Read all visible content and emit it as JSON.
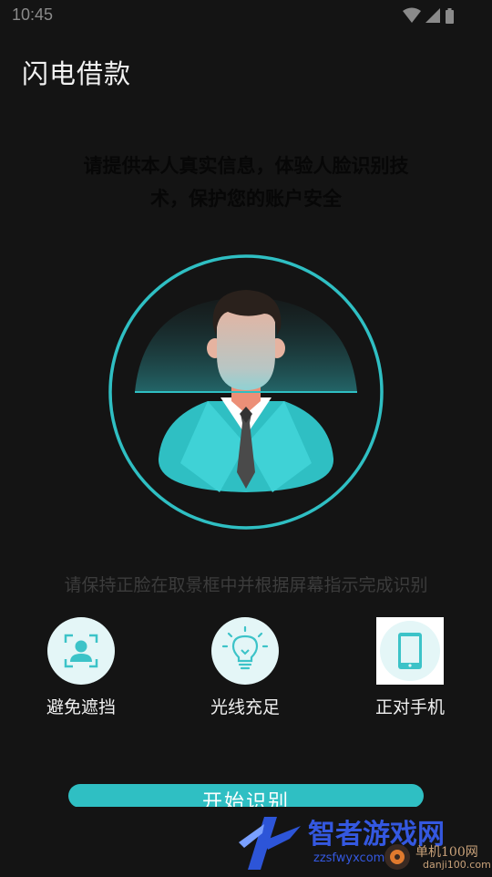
{
  "status_bar": {
    "time": "10:45",
    "icons": [
      "wifi-icon",
      "signal-icon",
      "battery-icon"
    ]
  },
  "app": {
    "title": "闪电借款"
  },
  "intro": {
    "line1": "请提供本人真实信息，体验人脸识别技",
    "line2": "术，保护您的账户安全"
  },
  "scanner": {
    "accent": "#2fbfc3"
  },
  "hint": "请保持正脸在取景框中并根据屏幕指示完成识别",
  "tips": [
    {
      "label": "避免遮挡",
      "icon": "face-frame-icon"
    },
    {
      "label": "光线充足",
      "icon": "lightbulb-icon"
    },
    {
      "label": "正对手机",
      "icon": "phone-icon"
    }
  ],
  "start_button": {
    "label": "开始识别"
  },
  "watermark": {
    "title": "智者游戏网",
    "url": "zzsfwyxcom",
    "badge": "单机100网",
    "badge_sub": "danji100.com"
  },
  "colors": {
    "background": "#141414",
    "accent": "#2fbfc3",
    "watermark_blue": "#3458e0"
  }
}
